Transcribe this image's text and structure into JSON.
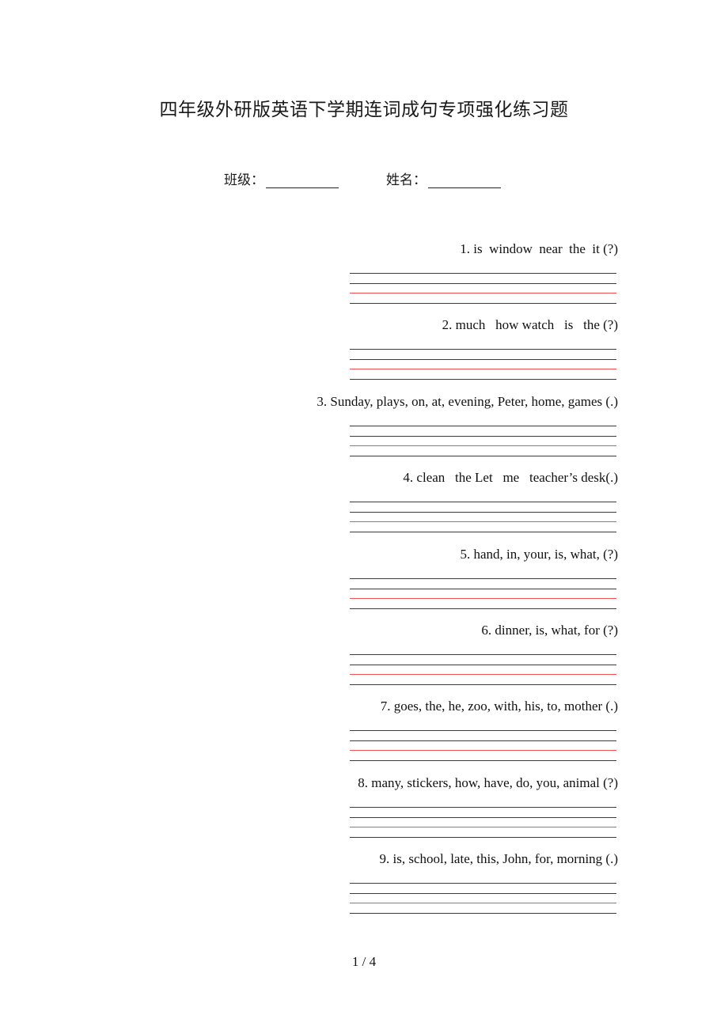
{
  "document": {
    "title": "四年级外研版英语下学期连词成句专项强化练习题",
    "fields": [
      {
        "label": "班级："
      },
      {
        "label": "姓名："
      }
    ],
    "line_colors": {
      "guide": "#3a3a3a",
      "baseline": "#f05050"
    },
    "questions": [
      {
        "text": "1. is  window  near  the  it (?)"
      },
      {
        "text": "2. much   how watch   is   the (?)"
      },
      {
        "text": "3. Sunday, plays, on, at, evening, Peter, home, games (.)"
      },
      {
        "text": "4. clean   the Let   me   teacher’s desk(.)"
      },
      {
        "text": "5. hand, in, your, is, what, (?)"
      },
      {
        "text": "6. dinner, is, what, for (?)"
      },
      {
        "text": "7. goes, the, he, zoo, with, his, to, mother (.)"
      },
      {
        "text": "8. many, stickers, how, have, do, you, animal (?)"
      },
      {
        "text": "9. is, school, late, this, John, for, morning (.)"
      }
    ],
    "page_number": "1 / 4"
  }
}
